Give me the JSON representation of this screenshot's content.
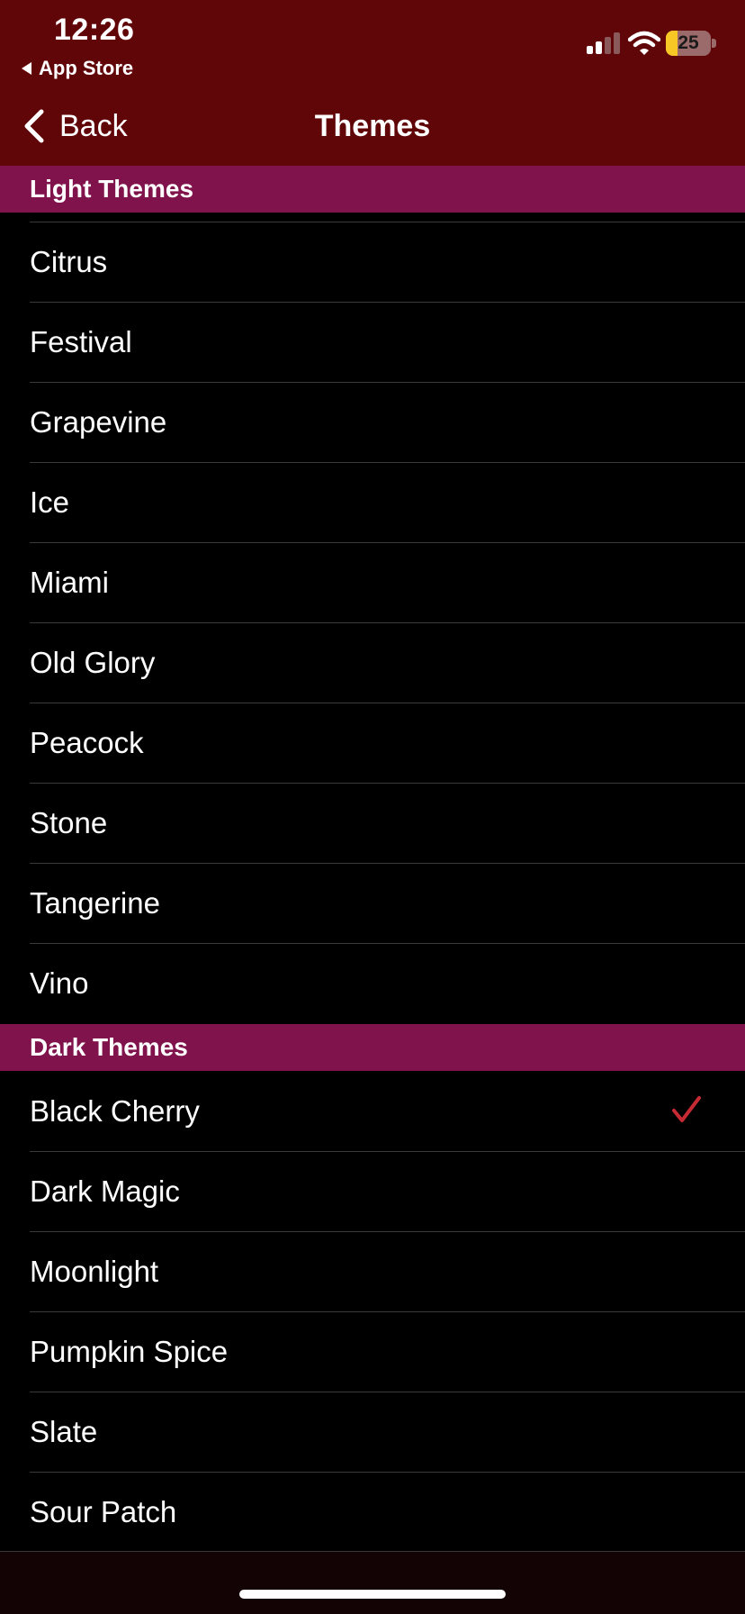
{
  "status_bar": {
    "time": "12:26",
    "back_app": "App Store",
    "battery_level": "25",
    "battery_fraction": 0.25,
    "icons": [
      "cellular-signal-icon",
      "wifi-icon",
      "battery-icon"
    ]
  },
  "nav": {
    "back_label": "Back",
    "title": "Themes"
  },
  "sections": {
    "light": {
      "title": "Light Themes",
      "items": [
        "Citrus",
        "Festival",
        "Grapevine",
        "Ice",
        "Miami",
        "Old Glory",
        "Peacock",
        "Stone",
        "Tangerine",
        "Vino"
      ]
    },
    "dark": {
      "title": "Dark Themes",
      "items": [
        "Black Cherry",
        "Dark Magic",
        "Moonlight",
        "Pumpkin Spice",
        "Slate",
        "Sour Patch"
      ],
      "selected": "Black Cherry"
    }
  },
  "colors": {
    "header_bg": "#600609",
    "section_bg": "#80134c",
    "checkmark": "#c62b34",
    "battery_fill": "#f7c825"
  }
}
